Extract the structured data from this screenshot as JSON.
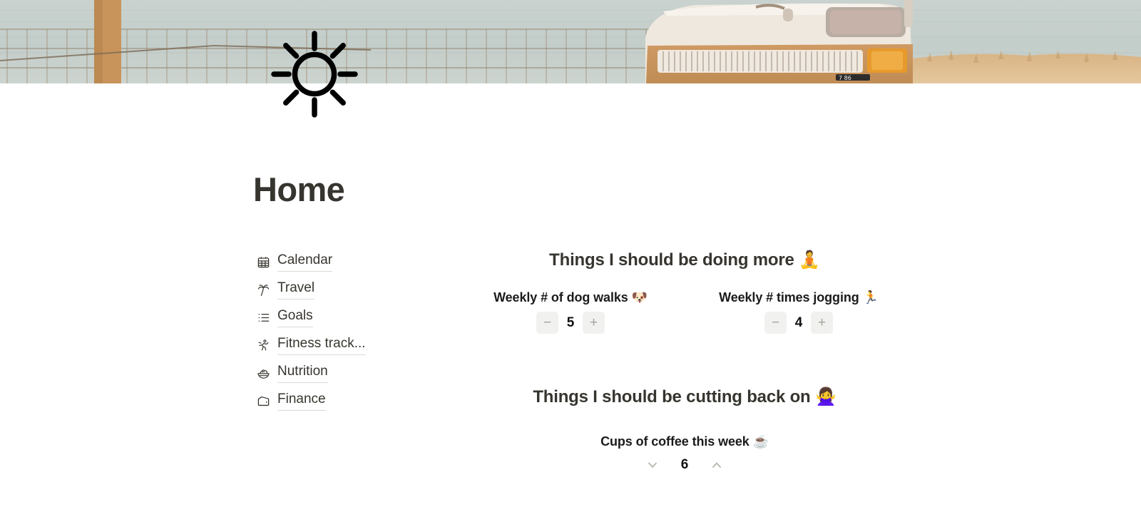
{
  "page": {
    "title": "Home",
    "icon": "sun-icon",
    "banner_alt": "vintage-van-beach-banner"
  },
  "colors": {
    "text": "#37352F",
    "button_bg": "#f1f1ef",
    "button_glyph": "#a5a29b",
    "underline": "#dcdad4"
  },
  "links": [
    {
      "label": "Calendar",
      "icon": "calendar-icon"
    },
    {
      "label": "Travel",
      "icon": "palm-tree-icon"
    },
    {
      "label": "Goals",
      "icon": "list-icon"
    },
    {
      "label": "Fitness track...",
      "icon": "running-person-icon"
    },
    {
      "label": "Nutrition",
      "icon": "salad-bowl-icon"
    },
    {
      "label": "Finance",
      "icon": "wallet-icon"
    }
  ],
  "sections": [
    {
      "heading": "Things I should be doing more 🧘",
      "counters": [
        {
          "label": "Weekly # of dog walks 🐶",
          "value": "5",
          "decrement": "−",
          "increment": "+"
        },
        {
          "label": "Weekly # times jogging 🏃",
          "value": "4",
          "decrement": "−",
          "increment": "+"
        }
      ]
    },
    {
      "heading": "Things I should be cutting back on 🙅‍♀️",
      "counters": [
        {
          "label": "Cups of coffee this week ☕",
          "value": "6",
          "decrement": "chevron-down",
          "increment": "chevron-up"
        }
      ]
    }
  ]
}
